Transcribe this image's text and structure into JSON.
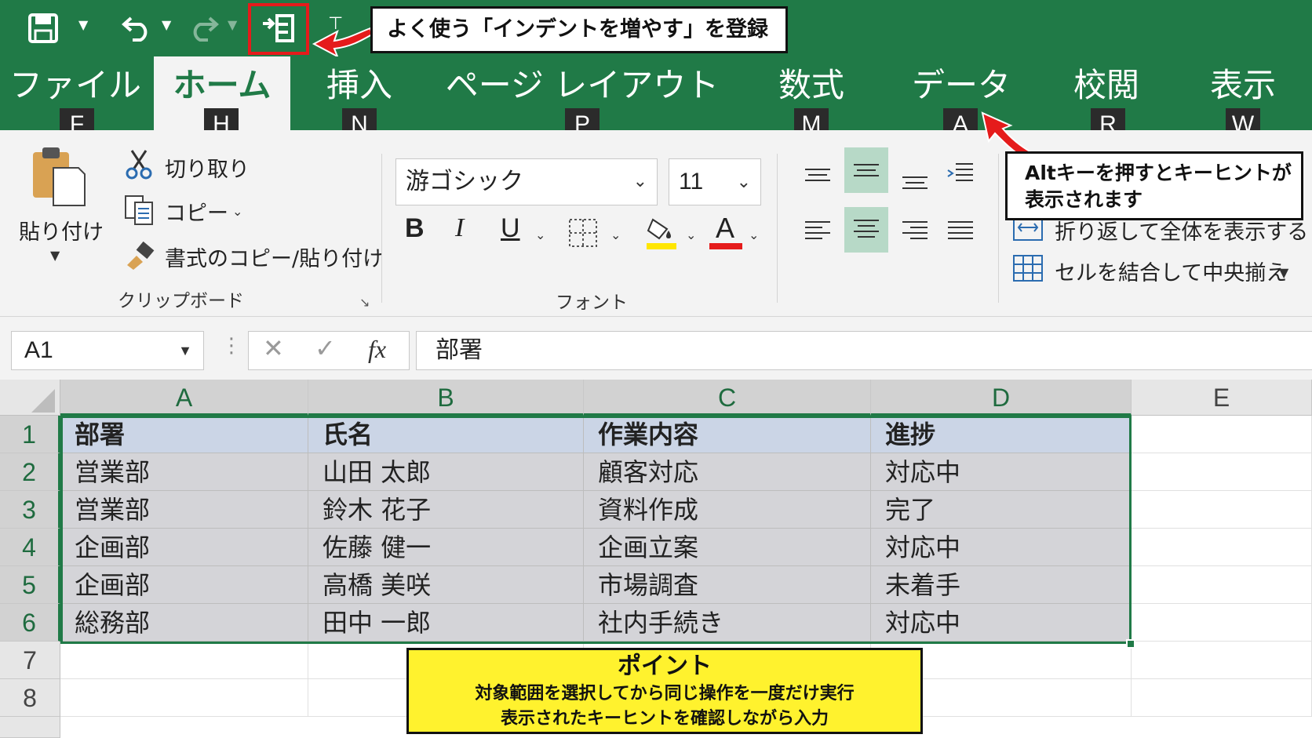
{
  "quick_access": {
    "callout": "よく使う「インデントを増やす」を登録"
  },
  "tabs": [
    {
      "label": "ファイル",
      "key": "F"
    },
    {
      "label": "ホーム",
      "key": "H"
    },
    {
      "label": "挿入",
      "key": "N"
    },
    {
      "label": "ページ レイアウト",
      "key": "P"
    },
    {
      "label": "数式",
      "key": "M"
    },
    {
      "label": "データ",
      "key": "A"
    },
    {
      "label": "校閲",
      "key": "R"
    },
    {
      "label": "表示",
      "key": "W"
    }
  ],
  "alt_callout": {
    "line1": "Altキーを押すとキーヒントが",
    "line2": "表示されます"
  },
  "clipboard": {
    "paste": "貼り付け",
    "cut": "切り取り",
    "copy": "コピー",
    "format_painter": "書式のコピー/貼り付け",
    "group_label": "クリップボード"
  },
  "font": {
    "name": "游ゴシック",
    "size": "11",
    "bold": "B",
    "italic": "I",
    "underline": "U",
    "font_color_letter": "A",
    "group_label": "フォント",
    "highlight_color": "#ffe600",
    "font_color": "#e51b1b"
  },
  "alignment": {
    "wrap_text": "折り返して全体を表示する",
    "merge_center": "セルを結合して中央揃え"
  },
  "formula_bar": {
    "name_box": "A1",
    "fx": "fx",
    "content": "部署"
  },
  "sheet": {
    "columns": [
      "A",
      "B",
      "C",
      "D",
      "E"
    ],
    "rows": [
      "1",
      "2",
      "3",
      "4",
      "5",
      "6",
      "7",
      "8"
    ],
    "header": [
      "部署",
      "氏名",
      "作業内容",
      "進捗"
    ],
    "data": [
      [
        "営業部",
        "山田 太郎",
        "顧客対応",
        "対応中"
      ],
      [
        "営業部",
        "鈴木 花子",
        "資料作成",
        "完了"
      ],
      [
        "企画部",
        "佐藤 健一",
        "企画立案",
        "対応中"
      ],
      [
        "企画部",
        "高橋 美咲",
        "市場調査",
        "未着手"
      ],
      [
        "総務部",
        "田中 一郎",
        "社内手続き",
        "対応中"
      ]
    ]
  },
  "point_box": {
    "title": "ポイント",
    "line1": "対象範囲を選択してから同じ操作を一度だけ実行",
    "line2": "表示されたキーヒントを確認しながら入力"
  },
  "colors": {
    "excel_green": "#207a47",
    "callout_red": "#e51b1b",
    "point_yellow": "#fff22e"
  }
}
